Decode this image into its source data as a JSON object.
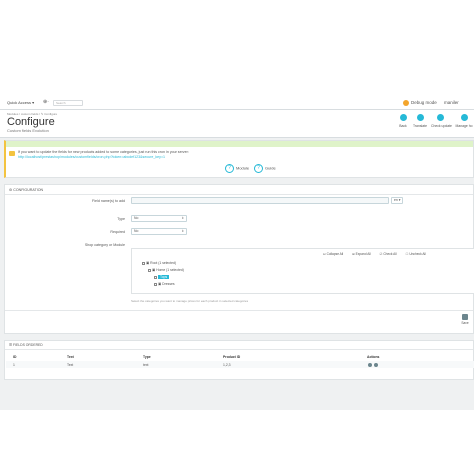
{
  "topbar": {
    "quick_access": "Quick Access ▾",
    "plus": "⊕·",
    "search_placeholder": "Search",
    "debug_mode": "Debug mode",
    "shop_name": "maniler"
  },
  "header": {
    "breadcrumb": "Modules  /  custom fields  /  ✎ Configure",
    "title": "Configure",
    "subtitle": "Custom fields Evolution",
    "toolbar": [
      {
        "label": "Back",
        "icon": "back-icon"
      },
      {
        "label": "Translate",
        "icon": "translate-icon"
      },
      {
        "label": "Check update",
        "icon": "update-icon"
      },
      {
        "label": "Manage ho",
        "icon": "hooks-icon"
      }
    ]
  },
  "notice": {
    "line1": "If you want to update the fields for new products added to some categories, just run this cron in your server:",
    "line2": "http://localhost/prestashop/modules/customfields/cron.php?token=abcdef123&secure_key=1",
    "btn1": "Module",
    "btn2": "Guide"
  },
  "config": {
    "panel_title": "CONFIGURATION",
    "field_name_label": "Field name(s) to add",
    "field_name_value": "",
    "lang_value": "en ▾",
    "type_label": "Type",
    "type_value": "No",
    "required_label": "Required",
    "required_value": "No",
    "category_label": "Shop category or Module",
    "tree_controls": [
      "Collapse All",
      "Expand All",
      "Check All",
      "Uncheck All"
    ],
    "tree": [
      {
        "label": "Root (1 selected)"
      },
      {
        "label": "Home (1 selected)"
      },
      {
        "label": "Tops"
      },
      {
        "label": "Dresses"
      }
    ],
    "hint": "Select the categories you want to manage prices for each product in selected categories",
    "save_label": "Save"
  },
  "list": {
    "panel_title": "FIELDS ORDERED",
    "columns": [
      "ID",
      "Text",
      "Type",
      "Product ID",
      "Actions"
    ],
    "rows": [
      {
        "id": "1",
        "text": "Text",
        "type": "text",
        "product_id": "1,2,3"
      }
    ]
  },
  "colors": {
    "accent": "#25b9d7",
    "warning": "#f3c33f",
    "success_bar": "#dff3c9",
    "background": "#eff1f2"
  }
}
